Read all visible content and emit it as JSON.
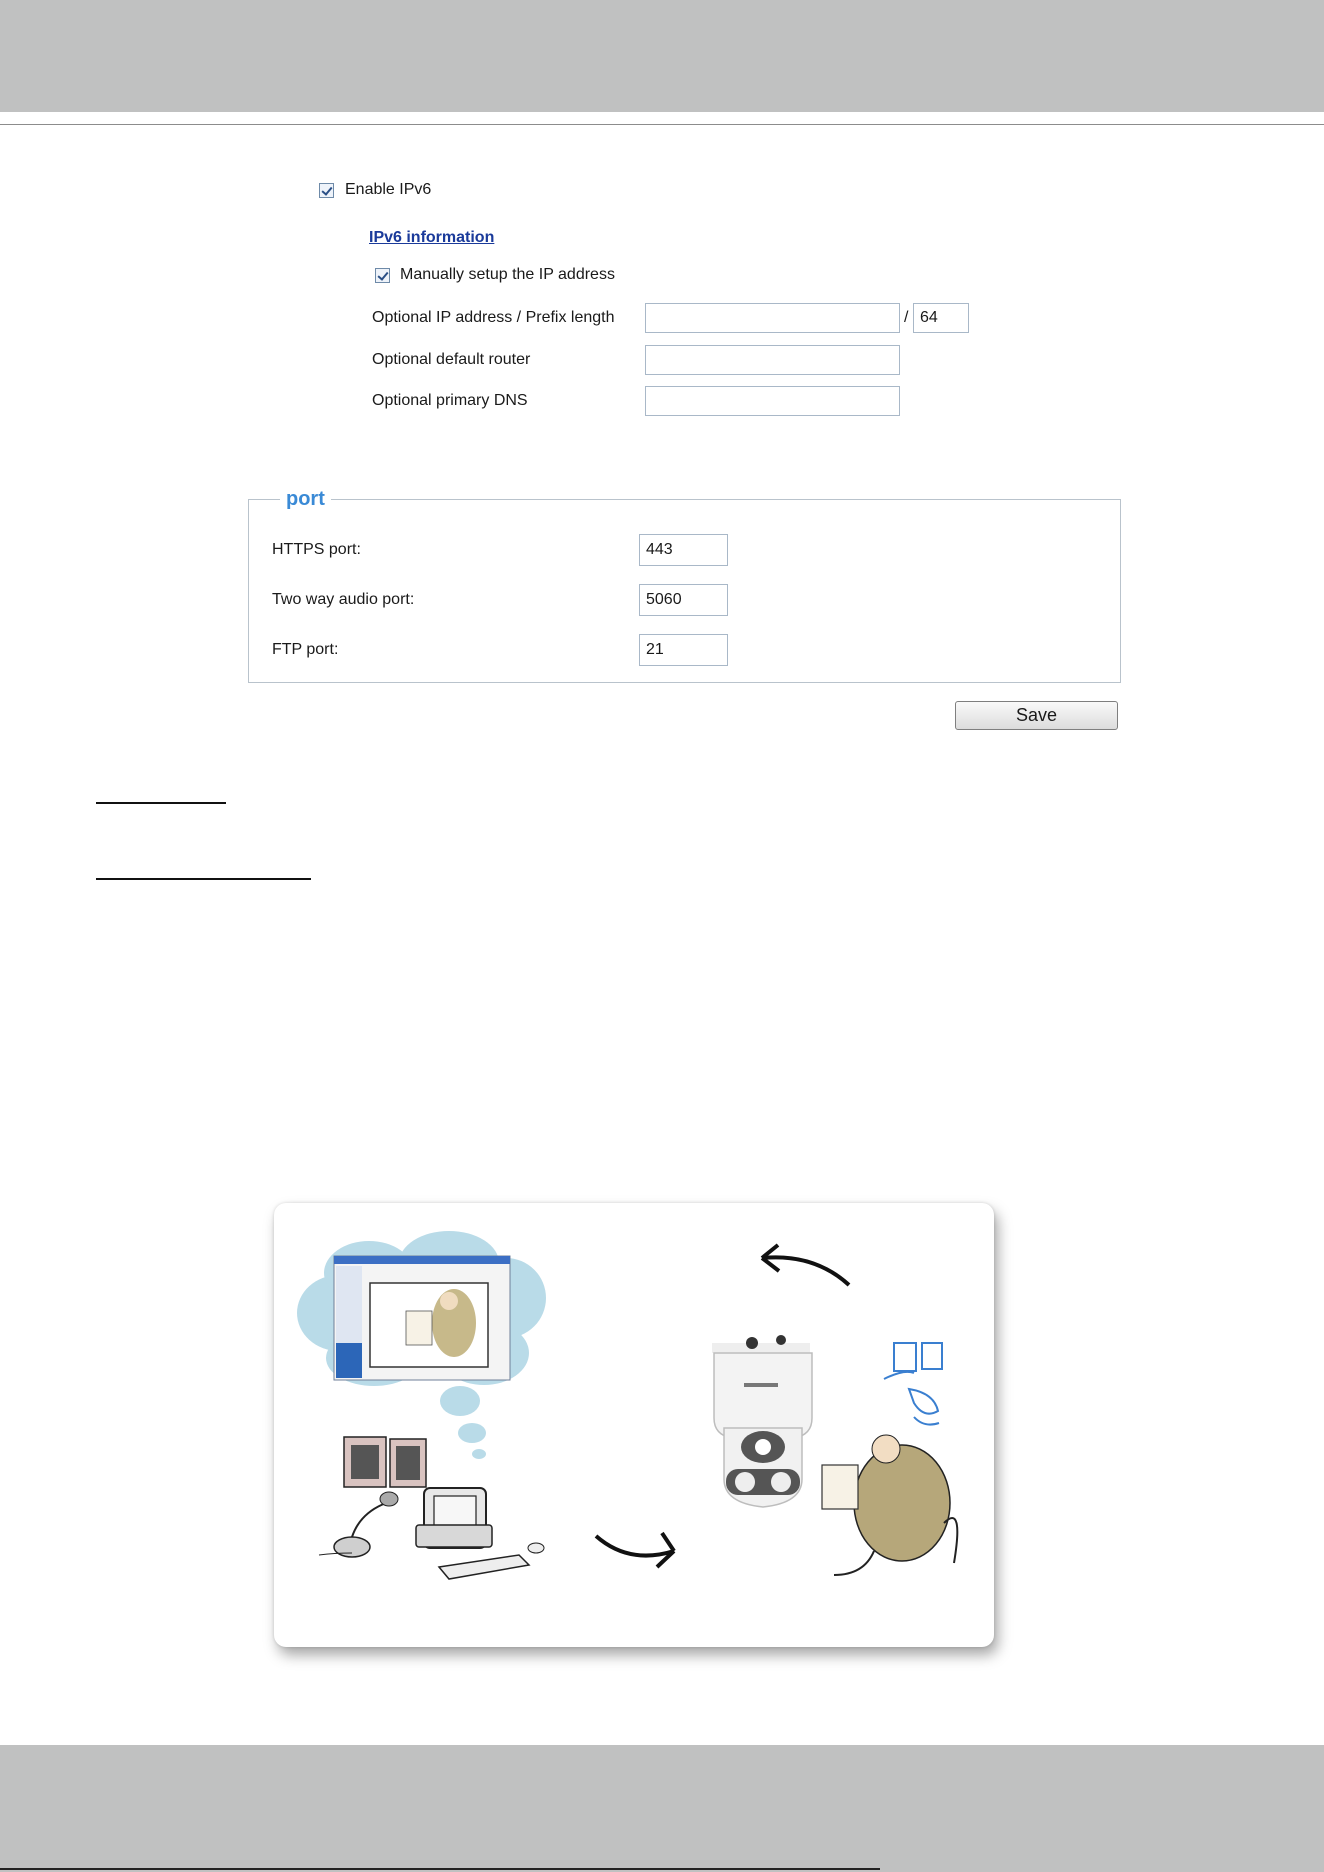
{
  "ipv6": {
    "enable_label": "Enable IPv6",
    "info_link": "IPv6 information",
    "manual_label": "Manually setup the IP address",
    "rows": [
      {
        "label": "Optional IP address / Prefix length",
        "value": ""
      },
      {
        "label": "Optional default router",
        "value": ""
      },
      {
        "label": "Optional primary DNS",
        "value": ""
      }
    ],
    "prefix_separator": "/",
    "prefix_value": "64"
  },
  "port": {
    "legend": "port",
    "rows": [
      {
        "label": "HTTPS port:",
        "value": "443"
      },
      {
        "label": "Two way audio port:",
        "value": "5060"
      },
      {
        "label": "FTP port:",
        "value": "21"
      }
    ],
    "save_label": "Save"
  }
}
